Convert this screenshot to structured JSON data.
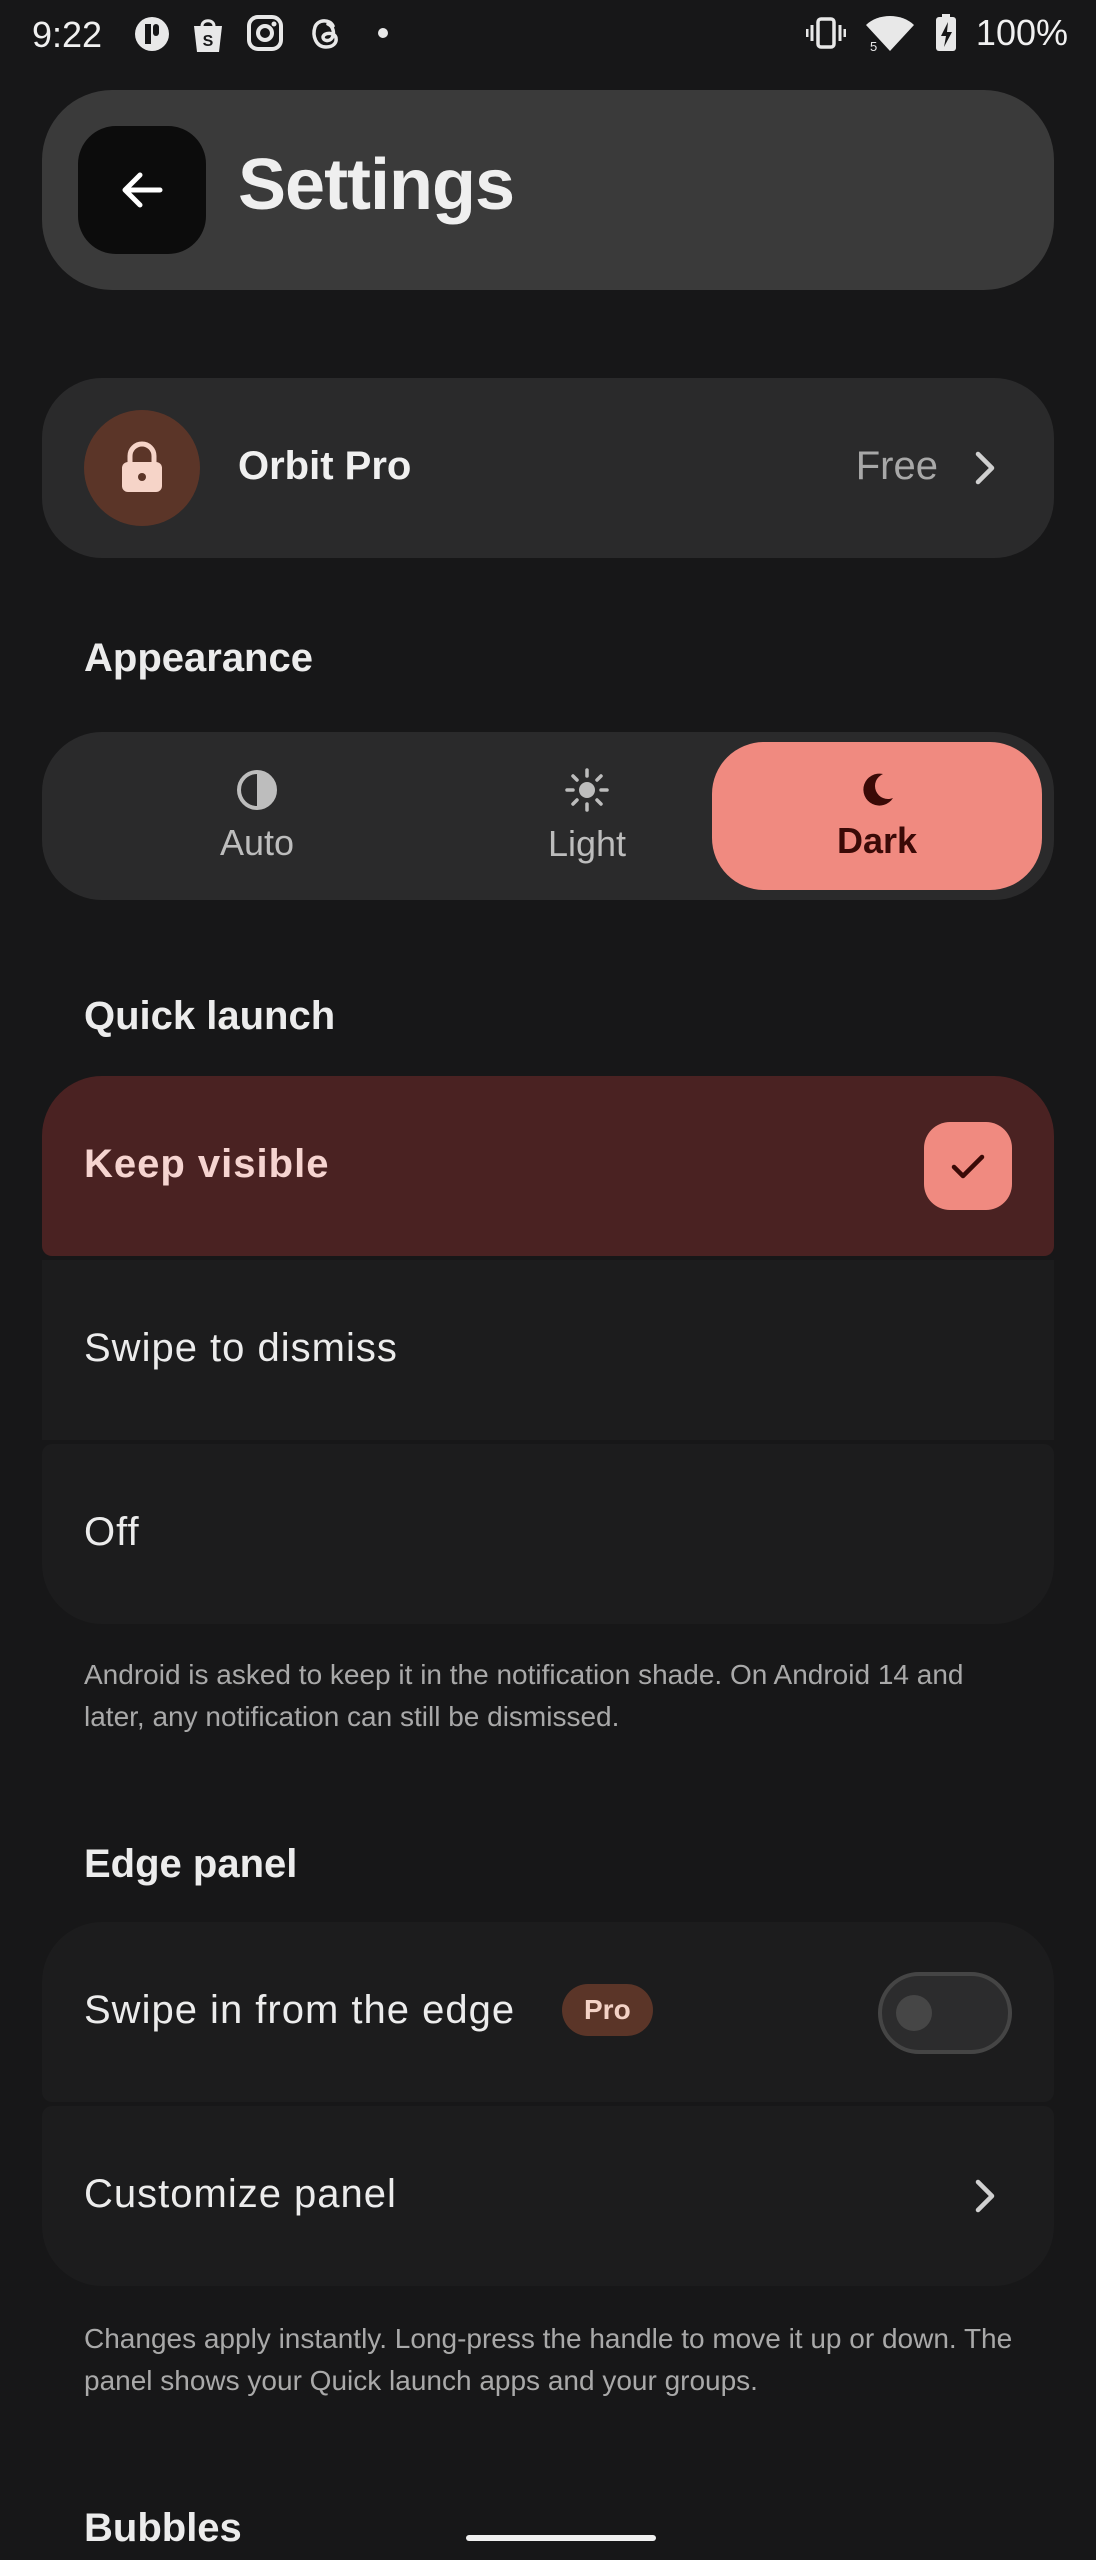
{
  "status_bar": {
    "time": "9:22",
    "battery": "100%",
    "left_icons": [
      "notification-app-icon",
      "shop-icon",
      "instagram-icon",
      "threads-icon",
      "dot-icon"
    ],
    "right_icons": [
      "vibrate-icon",
      "wifi-icon",
      "battery-charging-icon"
    ]
  },
  "header": {
    "title": "Settings",
    "back_icon": "arrow-left-icon"
  },
  "pro_card": {
    "label": "Orbit Pro",
    "status": "Free",
    "icon": "lock-icon",
    "avatar_color": "#5b3528"
  },
  "appearance": {
    "title": "Appearance",
    "options": [
      {
        "label": "Auto",
        "icon": "half-circle-icon",
        "selected": false
      },
      {
        "label": "Light",
        "icon": "sun-icon",
        "selected": false
      },
      {
        "label": "Dark",
        "icon": "moon-icon",
        "selected": true
      }
    ],
    "accent": "#f08a80"
  },
  "quick_launch": {
    "title": "Quick launch",
    "options": [
      {
        "label": "Keep visible",
        "selected": true
      },
      {
        "label": "Swipe to dismiss",
        "selected": false
      },
      {
        "label": "Off",
        "selected": false
      }
    ],
    "helper": "Android is asked to keep it in the notification shade. On Android 14 and later, any notification can still be dismissed."
  },
  "edge_panel": {
    "title": "Edge panel",
    "swipe_label": "Swipe in from the edge",
    "pro_badge": "Pro",
    "swipe_enabled": false,
    "customize_label": "Customize panel",
    "helper": "Changes apply instantly. Long-press the handle to move it up or down. The panel shows your Quick launch apps and your groups."
  },
  "bubbles": {
    "title": "Bubbles"
  },
  "colors": {
    "background": "#171718",
    "card": "#2a2a2b",
    "selected_row": "#4a2222",
    "accent": "#f08a80"
  }
}
